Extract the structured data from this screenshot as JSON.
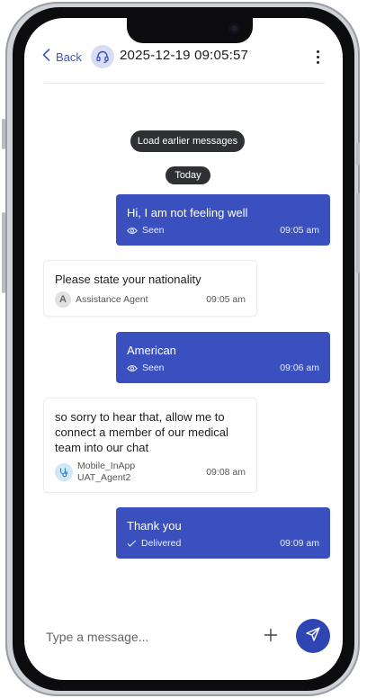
{
  "header": {
    "back_label": "Back",
    "title": "2025-12-19 09:05:57",
    "avatar_icon": "headset-icon",
    "menu_icon": "kebab-menu-icon"
  },
  "chat": {
    "load_earlier_label": "Load earlier messages",
    "date_separator": "Today",
    "messages": [
      {
        "direction": "outgoing",
        "text": "Hi, I am not feeling well",
        "status": "Seen",
        "status_icon": "eye-icon",
        "time": "09:05 am"
      },
      {
        "direction": "incoming",
        "text": "Please state your nationality",
        "sender": "Assistance Agent",
        "sender_initial": "A",
        "time": "09:05 am"
      },
      {
        "direction": "outgoing",
        "text": "American",
        "status": "Seen",
        "status_icon": "eye-icon",
        "time": "09:06 am"
      },
      {
        "direction": "incoming",
        "text_lines": [
          "so sorry to hear that, allow me to",
          "connect a member of our medical",
          "team into our chat"
        ],
        "sender_lines": [
          "Mobile_InApp",
          "UAT_Agent2"
        ],
        "sender_icon": "stethoscope-icon",
        "time": "09:08 am"
      },
      {
        "direction": "outgoing",
        "text": "Thank you",
        "status": "Delivered",
        "status_icon": "check-icon",
        "time": "09:09 am"
      }
    ]
  },
  "composer": {
    "placeholder": "Type a message...",
    "attach_icon": "plus-icon",
    "send_icon": "send-icon"
  },
  "colors": {
    "accent": "#3a50bf",
    "send_button": "#2f46b2",
    "pill": "#2f3033"
  }
}
